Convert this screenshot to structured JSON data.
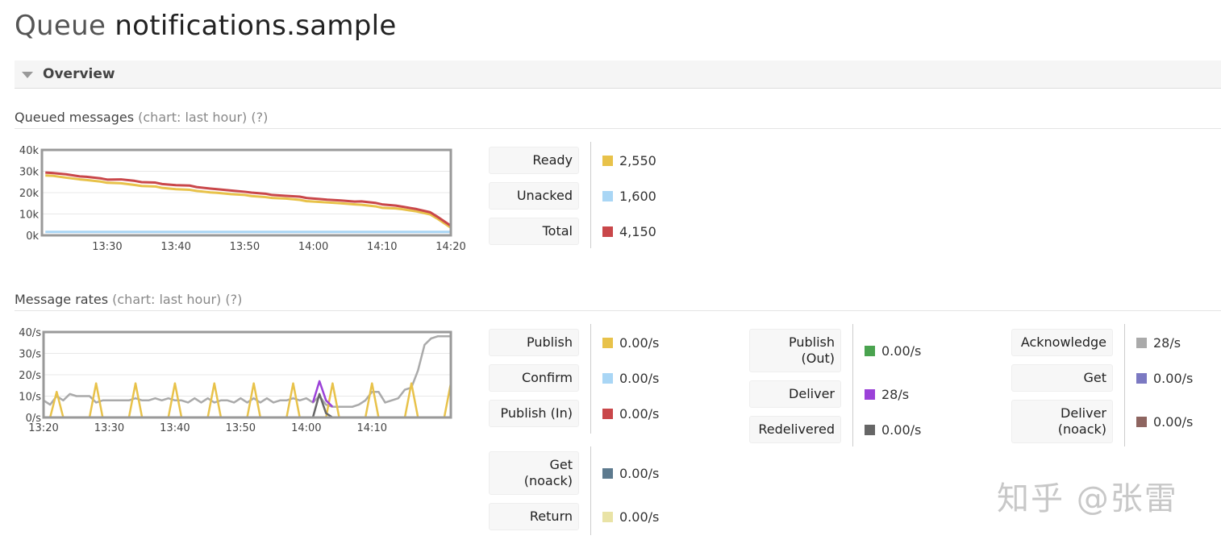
{
  "page": {
    "title_prefix": "Queue",
    "title_name": "notifications.sample"
  },
  "overview": {
    "label": "Overview",
    "queued": {
      "heading": "Queued messages",
      "heading_note": "(chart: last hour) (?)",
      "y_ticks": [
        "40k",
        "30k",
        "20k",
        "10k",
        "0k"
      ],
      "x_ticks": [
        "13:30",
        "13:40",
        "13:50",
        "14:00",
        "14:10",
        "14:20"
      ],
      "stats": [
        {
          "label": "Ready",
          "value": "2,550",
          "color": "#e8c24a"
        },
        {
          "label": "Unacked",
          "value": "1,600",
          "color": "#a9d6f5"
        },
        {
          "label": "Total",
          "value": "4,150",
          "color": "#c9474a"
        }
      ]
    },
    "rates": {
      "heading": "Message rates",
      "heading_note": "(chart: last hour) (?)",
      "y_ticks": [
        "40/s",
        "30/s",
        "20/s",
        "10/s",
        "0/s"
      ],
      "x_ticks": [
        "13:20",
        "13:30",
        "13:40",
        "13:50",
        "14:00",
        "14:10"
      ],
      "col1": [
        {
          "label": "Publish",
          "value": "0.00/s",
          "color": "#e8c24a"
        },
        {
          "label": "Confirm",
          "value": "0.00/s",
          "color": "#a9d6f5"
        },
        {
          "label": "Publish (In)",
          "value": "0.00/s",
          "color": "#c9474a"
        }
      ],
      "col1b": [
        {
          "label_line1": "Get",
          "label_line2": "(noack)",
          "value": "0.00/s",
          "color": "#5d7a8e"
        },
        {
          "label": "Return",
          "value": "0.00/s",
          "color": "#e9e3a6"
        }
      ],
      "col2": [
        {
          "label_line1": "Publish",
          "label_line2": "(Out)",
          "value": "0.00/s",
          "color": "#4aa34f"
        },
        {
          "label": "Deliver",
          "value": "28/s",
          "color": "#9b41d8"
        },
        {
          "label": "Redelivered",
          "value": "0.00/s",
          "color": "#666666"
        }
      ],
      "col3": [
        {
          "label": "Acknowledge",
          "value": "28/s",
          "color": "#aaaaaa"
        },
        {
          "label": "Get",
          "value": "0.00/s",
          "color": "#7b79c2"
        },
        {
          "label_line1": "Deliver",
          "label_line2": "(noack)",
          "value": "0.00/s",
          "color": "#8e6560"
        }
      ]
    }
  },
  "chart_data": [
    {
      "type": "line",
      "ylim": [
        0,
        40000
      ],
      "x": [
        "13:21",
        "13:22",
        "13:24",
        "13:26",
        "13:27",
        "13:29",
        "13:30",
        "13:32",
        "13:34",
        "13:35",
        "13:37",
        "13:38",
        "13:40",
        "13:42",
        "13:43",
        "13:45",
        "13:46",
        "13:48",
        "13:50",
        "13:51",
        "13:53",
        "13:54",
        "13:56",
        "13:58",
        "13:59",
        "14:01",
        "14:02",
        "14:04",
        "14:06",
        "14:07",
        "14:09",
        "14:10",
        "14:12",
        "14:13",
        "14:15",
        "14:17",
        "14:18",
        "14:20"
      ],
      "series": [
        {
          "name": "Ready",
          "values": [
            28000,
            27900,
            27000,
            26200,
            25900,
            25200,
            24600,
            24400,
            23600,
            23100,
            22900,
            22200,
            21600,
            21300,
            20800,
            20100,
            19900,
            19300,
            18900,
            18400,
            17900,
            17500,
            17200,
            16600,
            16000,
            15600,
            15400,
            15000,
            14500,
            14300,
            13600,
            12900,
            12600,
            12200,
            11200,
            9800,
            7900,
            3600
          ]
        },
        {
          "name": "Unacked",
          "values": [
            1600,
            1600,
            1600,
            1600,
            1600,
            1600,
            1600,
            1600,
            1600,
            1600,
            1600,
            1600,
            1600,
            1600,
            1600,
            1600,
            1600,
            1600,
            1600,
            1600,
            1600,
            1600,
            1600,
            1600,
            1600,
            1600,
            1600,
            1600,
            1600,
            1600,
            1600,
            1600,
            1600,
            1600,
            1600,
            1600,
            1600,
            1600
          ]
        },
        {
          "name": "Total",
          "values": [
            29400,
            29200,
            28600,
            27600,
            27400,
            26700,
            26100,
            26200,
            25500,
            24900,
            24700,
            24000,
            23500,
            23300,
            22600,
            21900,
            21600,
            21000,
            20400,
            20000,
            19500,
            18900,
            18500,
            18100,
            17500,
            17000,
            16700,
            16300,
            15800,
            15900,
            15200,
            14500,
            13900,
            13400,
            12300,
            10800,
            8800,
            4500
          ]
        }
      ]
    },
    {
      "type": "line",
      "ylim": [
        0,
        40
      ],
      "series": [
        {
          "name": "Publish",
          "x": [
            "13:20",
            "13:21",
            "13:22",
            "13:23",
            "13:24",
            "13:25",
            "13:26",
            "13:27",
            "13:28",
            "13:29",
            "13:30",
            "13:31",
            "13:32",
            "13:33",
            "13:34",
            "13:35",
            "13:36",
            "13:37",
            "13:38",
            "13:39",
            "13:40",
            "13:41",
            "13:42",
            "13:43",
            "13:44",
            "13:45",
            "13:46",
            "13:47",
            "13:48",
            "13:49",
            "13:50",
            "13:51",
            "13:52",
            "13:53",
            "13:54",
            "13:55",
            "13:56",
            "13:57",
            "13:58",
            "13:59",
            "14:00",
            "14:01",
            "14:02",
            "14:03",
            "14:04",
            "14:05",
            "14:06",
            "14:07",
            "14:08",
            "14:09",
            "14:10",
            "14:11",
            "14:12",
            "14:13",
            "14:14",
            "14:15",
            "14:16",
            "14:17",
            "14:18",
            "14:19",
            "14:20",
            "14:21",
            "14:22"
          ],
          "values": [
            0,
            0,
            12,
            0,
            0,
            0,
            0,
            0,
            16,
            0,
            0,
            0,
            0,
            0,
            16,
            0,
            0,
            0,
            0,
            0,
            16,
            0,
            0,
            0,
            0,
            0,
            16,
            0,
            0,
            0,
            0,
            0,
            16,
            0,
            0,
            0,
            0,
            0,
            16,
            0,
            0,
            0,
            0,
            0,
            16,
            0,
            0,
            0,
            0,
            0,
            16,
            0,
            0,
            0,
            0,
            0,
            16,
            0,
            0,
            0,
            0,
            0,
            16
          ]
        },
        {
          "name": "Deliver",
          "x": [
            "14:01",
            "14:02",
            "14:03",
            "14:04"
          ],
          "values": [
            7,
            17,
            8,
            5
          ]
        },
        {
          "name": "Redelivered",
          "x": [
            "14:01",
            "14:02",
            "14:03",
            "14:04"
          ],
          "values": [
            0,
            11,
            2,
            0
          ]
        },
        {
          "name": "Acknowledge",
          "x": [
            "13:20",
            "13:21",
            "13:22",
            "13:23",
            "13:24",
            "13:25",
            "13:26",
            "13:27",
            "13:28",
            "13:29",
            "13:30",
            "13:31",
            "13:32",
            "13:33",
            "13:34",
            "13:35",
            "13:36",
            "13:37",
            "13:38",
            "13:39",
            "13:40",
            "13:41",
            "13:42",
            "13:43",
            "13:44",
            "13:45",
            "13:46",
            "13:47",
            "13:48",
            "13:49",
            "13:50",
            "13:51",
            "13:52",
            "13:53",
            "13:54",
            "13:55",
            "13:56",
            "13:57",
            "13:58",
            "13:59",
            "14:00",
            "14:01",
            "14:02",
            "14:03",
            "14:04",
            "14:05",
            "14:06",
            "14:07",
            "14:08",
            "14:09",
            "14:10",
            "14:11",
            "14:12",
            "14:13",
            "14:14",
            "14:15",
            "14:16",
            "14:17",
            "14:18",
            "14:19",
            "14:20",
            "14:21",
            "14:22"
          ],
          "values": [
            8,
            6,
            10,
            8,
            11,
            10,
            10,
            10,
            7,
            8,
            8,
            8,
            8,
            8,
            9,
            8,
            8,
            9,
            8,
            9,
            8,
            8,
            7,
            9,
            7,
            9,
            7,
            8,
            8,
            7,
            9,
            7,
            9,
            7,
            9,
            7,
            8,
            8,
            9,
            8,
            9,
            7,
            10,
            6,
            5,
            5,
            5,
            5,
            6,
            8,
            12,
            12,
            7,
            8,
            9,
            13,
            14,
            22,
            34,
            37,
            38,
            38,
            38
          ]
        }
      ]
    }
  ]
}
